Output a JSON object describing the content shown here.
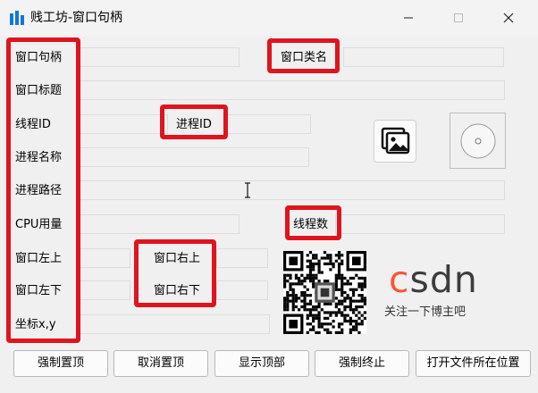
{
  "window": {
    "title": "贱工坊-窗口句柄",
    "minimize_icon": "minimize-icon",
    "maximize_icon": "maximize-icon",
    "close_icon": "close-icon"
  },
  "labels": {
    "window_handle": "窗口句柄",
    "window_class": "窗口类名",
    "window_title": "窗口标题",
    "thread_id": "线程ID",
    "process_id": "进程ID",
    "process_name": "进程名称",
    "process_path": "进程路径",
    "cpu_usage": "CPU用量",
    "thread_count": "线程数",
    "window_top_left": "窗口左上",
    "window_top_right": "窗口右上",
    "window_bottom_left": "窗口左下",
    "window_bottom_right": "窗口右下",
    "coordinates": "坐标x,y"
  },
  "fields": {
    "window_handle": "",
    "window_class": "",
    "window_title": "",
    "thread_id": "",
    "process_id": "",
    "process_name": "",
    "process_path": "",
    "cpu_usage": "",
    "thread_count": "",
    "window_top_left": "",
    "window_top_right": "",
    "window_bottom_left": "",
    "window_bottom_right": "",
    "coordinates": ""
  },
  "buttons": {
    "force_top": "强制置顶",
    "cancel_top": "取消置顶",
    "show_top": "显示顶部",
    "force_terminate": "强制终止",
    "open_location": "打开文件所在位置"
  },
  "branding": {
    "csdn_c": "c",
    "csdn_rest": "sdn",
    "follow_text": "关注一下博主吧"
  },
  "icons": {
    "image_button": "image-icon",
    "window_icon_preview": "circle-icon",
    "qr_code": "qr-code-icon",
    "text_cursor": "text-cursor-icon"
  },
  "colors": {
    "highlight_red": "#e0141e",
    "csdn_orange": "#fc5531",
    "app_icon_blue": "#1677d2"
  }
}
